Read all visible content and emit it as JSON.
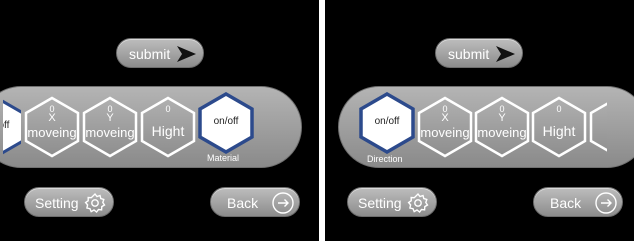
{
  "panels": [
    {
      "submit_label": "submit",
      "setting_label": "Setting",
      "back_label": "Back",
      "partial_left_label": "on/off",
      "hexes": [
        {
          "top": "0",
          "axis": "X",
          "label": "moveing"
        },
        {
          "top": "0",
          "axis": "Y",
          "label": "moveing"
        },
        {
          "top": "0",
          "axis": "",
          "label": "Hight"
        }
      ],
      "selected_hex": {
        "label": "on/off",
        "caption": "Material"
      }
    },
    {
      "submit_label": "submit",
      "setting_label": "Setting",
      "back_label": "Back",
      "selected_hex": {
        "label": "on/off",
        "caption": "Direction"
      },
      "hexes": [
        {
          "top": "0",
          "axis": "X",
          "label": "moveing"
        },
        {
          "top": "0",
          "axis": "Y",
          "label": "moveing"
        },
        {
          "top": "0",
          "axis": "",
          "label": "Hight"
        }
      ]
    }
  ],
  "colors": {
    "background": "#000000",
    "button_fill": "#a6a6a6",
    "selected_outline": "#2c4a8c",
    "hex_outline": "#ffffff"
  },
  "icons": [
    "send-arrow-icon",
    "gear-icon",
    "exit-arrow-icon"
  ]
}
